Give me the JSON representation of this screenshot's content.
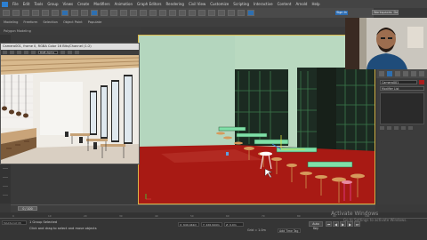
{
  "app": {
    "menu": [
      "File",
      "Edit",
      "Tools",
      "Group",
      "Views",
      "Create",
      "Modifiers",
      "Animation",
      "Graph Editors",
      "Rendering",
      "Civil View",
      "Customize",
      "Scripting",
      "Interactive",
      "Content",
      "Arnold",
      "Help"
    ],
    "sign_in": "Sign In",
    "workspace": "Workspaces: Default"
  },
  "toolbar2": {
    "items": [
      "Modeling",
      "Freeform",
      "Selection",
      "Object Paint",
      "Populate"
    ]
  },
  "toolbar3": {
    "items": [
      "Polygon Modeling"
    ]
  },
  "frame_buffer": {
    "title": "Camera001, frame 0, RGBA Color 16 Bits/Channel (1:2)",
    "channel": "RGB Alpha"
  },
  "viewport": {
    "colors": {
      "floor": "#a81a14",
      "wall": "#b9d9c0",
      "window_frame": "#1e2a22",
      "table": "#7fe0a8",
      "stool": "#d69a5c"
    }
  },
  "command_panel": {
    "object_name": "Camera001",
    "modifier_list": "Modifier List"
  },
  "timeline": {
    "frame": "0 / 100",
    "ruler_labels": [
      "0",
      "10",
      "20",
      "30",
      "40",
      "50",
      "60",
      "70",
      "80",
      "90",
      "100"
    ]
  },
  "status": {
    "maxscript": "MAXScript Mi",
    "selection": "1 Group Selected",
    "prompt": "Click and drag to select and move objects",
    "x": "X: 640.442m",
    "y": "Y: 226.944m",
    "z": "Z: 0.0m",
    "grid": "Grid = 1.0m",
    "add_time_tag": "Add Time Tag",
    "auto_key": "Auto Key",
    "set_key": "Set Key",
    "selected": "Selected"
  },
  "watermark": {
    "line1": "Activate Windows",
    "line2": "Go to Settings to activate Windows."
  }
}
